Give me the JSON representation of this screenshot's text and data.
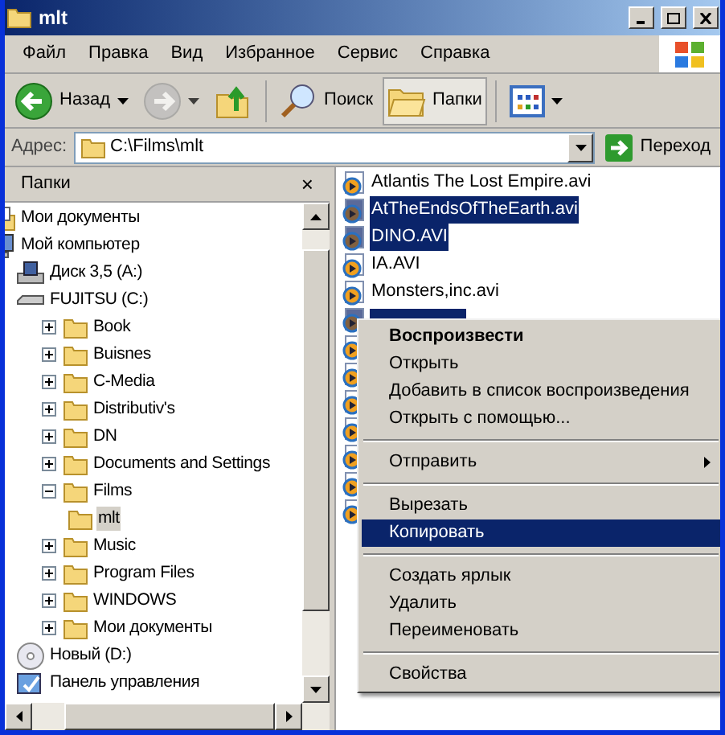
{
  "window": {
    "title": "mlt"
  },
  "menu_bar": [
    "Файл",
    "Правка",
    "Вид",
    "Избранное",
    "Сервис",
    "Справка"
  ],
  "toolbar": [
    {
      "kind": "back",
      "label": "Назад",
      "disabled": false,
      "selected": false
    },
    {
      "kind": "forward",
      "disabled": true,
      "selected": false
    },
    {
      "kind": "up",
      "disabled": false,
      "selected": false
    },
    {
      "kind": "search",
      "label": "Поиск",
      "disabled": false,
      "selected": false
    },
    {
      "kind": "folders",
      "label": "Папки",
      "disabled": false,
      "selected": true
    },
    {
      "kind": "views",
      "disabled": false,
      "selected": false
    }
  ],
  "address_bar": {
    "label": "Адрес:",
    "value": "C:\\Films\\mlt",
    "go_label": "Переход"
  },
  "folders_pane": {
    "title": "Папки",
    "close": "×",
    "tree": [
      {
        "name": "Мои документы",
        "kind": "docs",
        "selected": false
      },
      {
        "name": "Мой компьютер",
        "kind": "computer",
        "selected": false,
        "children": [
          {
            "name": "Диск 3,5 (A:)",
            "kind": "floppy",
            "selected": false
          },
          {
            "name": "FUJITSU (C:)",
            "kind": "disk",
            "selected": false,
            "children": [
              {
                "name": "Book",
                "kind": "folder",
                "expanded": false,
                "selected": false
              },
              {
                "name": "Buisnes",
                "kind": "folder",
                "expanded": false,
                "selected": false
              },
              {
                "name": "C-Media",
                "kind": "folder",
                "expanded": false,
                "selected": false
              },
              {
                "name": "Distributiv's",
                "kind": "folder",
                "expanded": false,
                "selected": false
              },
              {
                "name": "DN",
                "kind": "folder",
                "expanded": false,
                "selected": false
              },
              {
                "name": "Documents and Settings",
                "kind": "folder",
                "expanded": false,
                "selected": false
              },
              {
                "name": "Films",
                "kind": "folder",
                "expanded": true,
                "selected": false,
                "children": [
                  {
                    "name": "mlt",
                    "kind": "folder",
                    "selected": true
                  }
                ]
              },
              {
                "name": "Music",
                "kind": "folder",
                "expanded": false,
                "selected": false
              },
              {
                "name": "Program Files",
                "kind": "folder",
                "expanded": false,
                "selected": false
              },
              {
                "name": "WINDOWS",
                "kind": "folder",
                "expanded": false,
                "selected": false
              },
              {
                "name": "Мои документы",
                "kind": "folder",
                "expanded": false,
                "selected": false
              }
            ]
          },
          {
            "name": "Новый (D:)",
            "kind": "cd",
            "selected": false
          },
          {
            "name": "Панель управления",
            "kind": "control",
            "selected": false
          }
        ]
      }
    ]
  },
  "files": [
    {
      "name": "Atlantis The Lost Empire.avi",
      "selected": false
    },
    {
      "name": "AtTheEndsOfTheEarth.avi",
      "selected": true
    },
    {
      "name": "DINO.AVI",
      "selected": true
    },
    {
      "name": "IA.AVI",
      "selected": false
    },
    {
      "name": "Monsters,inc.avi",
      "selected": false
    },
    {
      "selected": true
    },
    {
      "selected": false
    },
    {
      "selected": false
    },
    {
      "selected": false
    },
    {
      "selected": false
    },
    {
      "selected": false
    },
    {
      "selected": false
    },
    {
      "selected": false
    }
  ],
  "context_menu": [
    {
      "kind": "item",
      "label": "Воспроизвести",
      "default": true,
      "selected": false
    },
    {
      "kind": "item",
      "label": "Открыть",
      "default": false,
      "selected": false
    },
    {
      "kind": "item",
      "label": "Добавить в список воспроизведения",
      "default": false,
      "selected": false
    },
    {
      "kind": "item",
      "label": "Открыть с помощью...",
      "default": false,
      "selected": false
    },
    {
      "kind": "separator"
    },
    {
      "kind": "submenu",
      "label": "Отправить",
      "default": false,
      "selected": false
    },
    {
      "kind": "separator"
    },
    {
      "kind": "item",
      "label": "Вырезать",
      "default": false,
      "selected": false
    },
    {
      "kind": "item",
      "label": "Копировать",
      "default": false,
      "selected": true
    },
    {
      "kind": "separator"
    },
    {
      "kind": "item",
      "label": "Создать ярлык",
      "default": false,
      "selected": false
    },
    {
      "kind": "item",
      "label": "Удалить",
      "default": false,
      "selected": false
    },
    {
      "kind": "item",
      "label": "Переименовать",
      "default": false,
      "selected": false
    },
    {
      "kind": "separator"
    },
    {
      "kind": "item",
      "label": "Свойства",
      "default": false,
      "selected": false
    }
  ]
}
